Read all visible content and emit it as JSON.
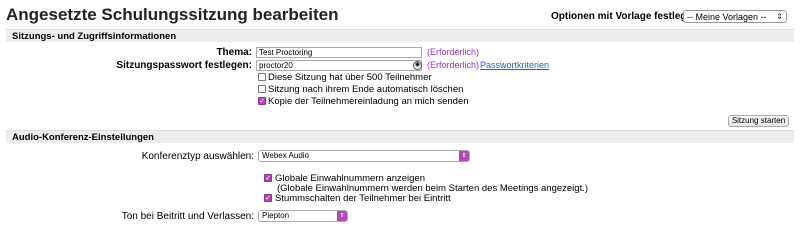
{
  "header": {
    "title": "Angesetzte Schulungssitzung bearbeiten",
    "template_label": "Optionen mit Vorlage festlegen:",
    "template_select": "-- Meine Vorlagen --"
  },
  "session_section": {
    "title": "Sitzungs- und Zugriffsinformationen",
    "topic_label": "Thema:",
    "topic_value": "Test Proctoring",
    "topic_required": "(Erforderlich)",
    "password_label": "Sitzungspasswort festlegen:",
    "password_value": "proctor20",
    "password_required": "(Erforderlich)",
    "password_criteria_link": "Passwortkriterien",
    "options": [
      {
        "label": "Diese Sitzung hat über 500 Teilnehmer",
        "checked": false
      },
      {
        "label": "Sitzung nach ihrem Ende automatisch löschen",
        "checked": false
      },
      {
        "label": "Kopie der Teilnehmereinladung an mich senden",
        "checked": true
      }
    ],
    "start_button": "Sitzung starten"
  },
  "audio_section": {
    "title": "Audio-Konferenz-Einstellungen",
    "conference_type_label": "Konferenztyp auswählen:",
    "conference_type_value": "Webex Audio",
    "global_numbers_label": "Globale Einwahlnummern anzeigen",
    "global_numbers_checked": true,
    "global_numbers_note": "(Globale Einwahlnummern werden beim Starten des Meetings angezeigt.)",
    "mute_label": "Stummschalten der Teilnehmer bei Eintritt",
    "mute_checked": true,
    "tone_label": "Ton bei Beitritt und Verlassen:",
    "tone_value": "Piepton"
  },
  "colors": {
    "accent": "#b347b3",
    "required": "#9933cc",
    "link": "#1a66cc",
    "section_bar": "#ececec"
  }
}
